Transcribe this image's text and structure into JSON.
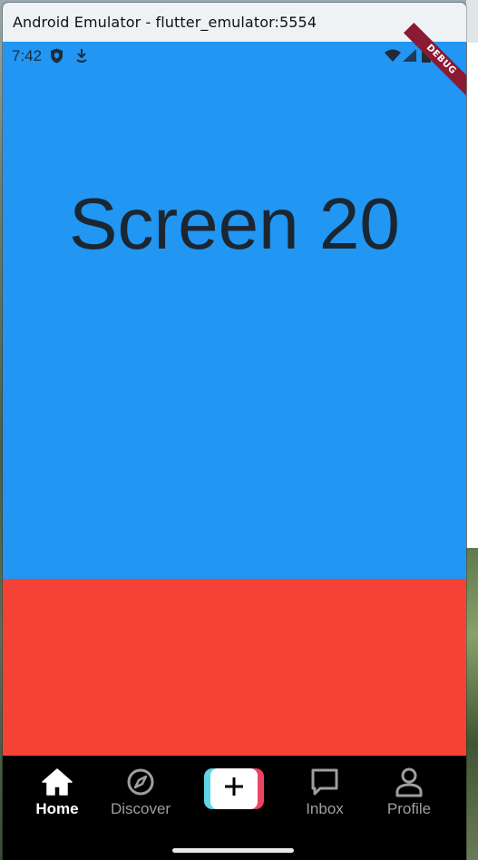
{
  "window": {
    "title": "Android Emulator - flutter_emulator:5554"
  },
  "status_bar": {
    "time": "7:42",
    "icons": [
      "shield-icon",
      "download-icon",
      "wifi-icon",
      "signal-icon",
      "battery-icon"
    ]
  },
  "debug_banner": "DEBUG",
  "screen": {
    "title": "Screen 20",
    "top_color": "#2196f3",
    "bottom_color": "#f44336"
  },
  "bottom_nav": {
    "items": [
      {
        "label": "Home",
        "icon": "home-icon",
        "active": true
      },
      {
        "label": "Discover",
        "icon": "compass-icon",
        "active": false
      },
      {
        "label": "",
        "icon": "plus-icon",
        "active": false
      },
      {
        "label": "Inbox",
        "icon": "chat-bubble-icon",
        "active": false
      },
      {
        "label": "Profile",
        "icon": "person-icon",
        "active": false
      }
    ]
  }
}
